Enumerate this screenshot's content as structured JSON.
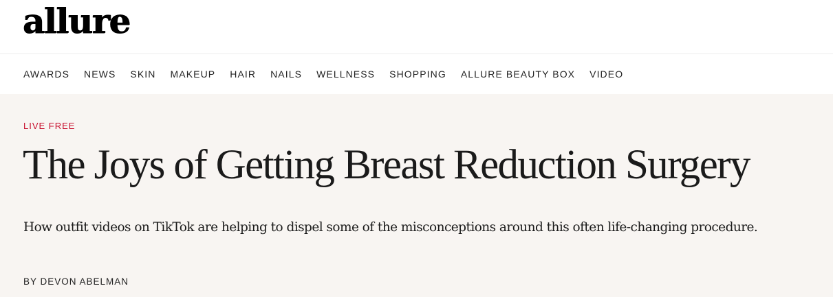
{
  "header": {
    "logo_text": "allure"
  },
  "nav": {
    "items": [
      {
        "label": "AWARDS"
      },
      {
        "label": "NEWS"
      },
      {
        "label": "SKIN"
      },
      {
        "label": "MAKEUP"
      },
      {
        "label": "HAIR"
      },
      {
        "label": "NAILS"
      },
      {
        "label": "WELLNESS"
      },
      {
        "label": "SHOPPING"
      },
      {
        "label": "ALLURE BEAUTY BOX"
      },
      {
        "label": "VIDEO"
      }
    ]
  },
  "article": {
    "rubric": "LIVE FREE",
    "headline": "The Joys of Getting Breast Reduction Surgery",
    "dek": "How outfit videos on TikTok are helping to dispel some of the misconceptions around this often life-changing procedure.",
    "byline": "BY DEVON ABELMAN"
  },
  "colors": {
    "rubric": "#c8102e",
    "hero_background": "#f8f5f2",
    "text": "#1a1a1a"
  }
}
